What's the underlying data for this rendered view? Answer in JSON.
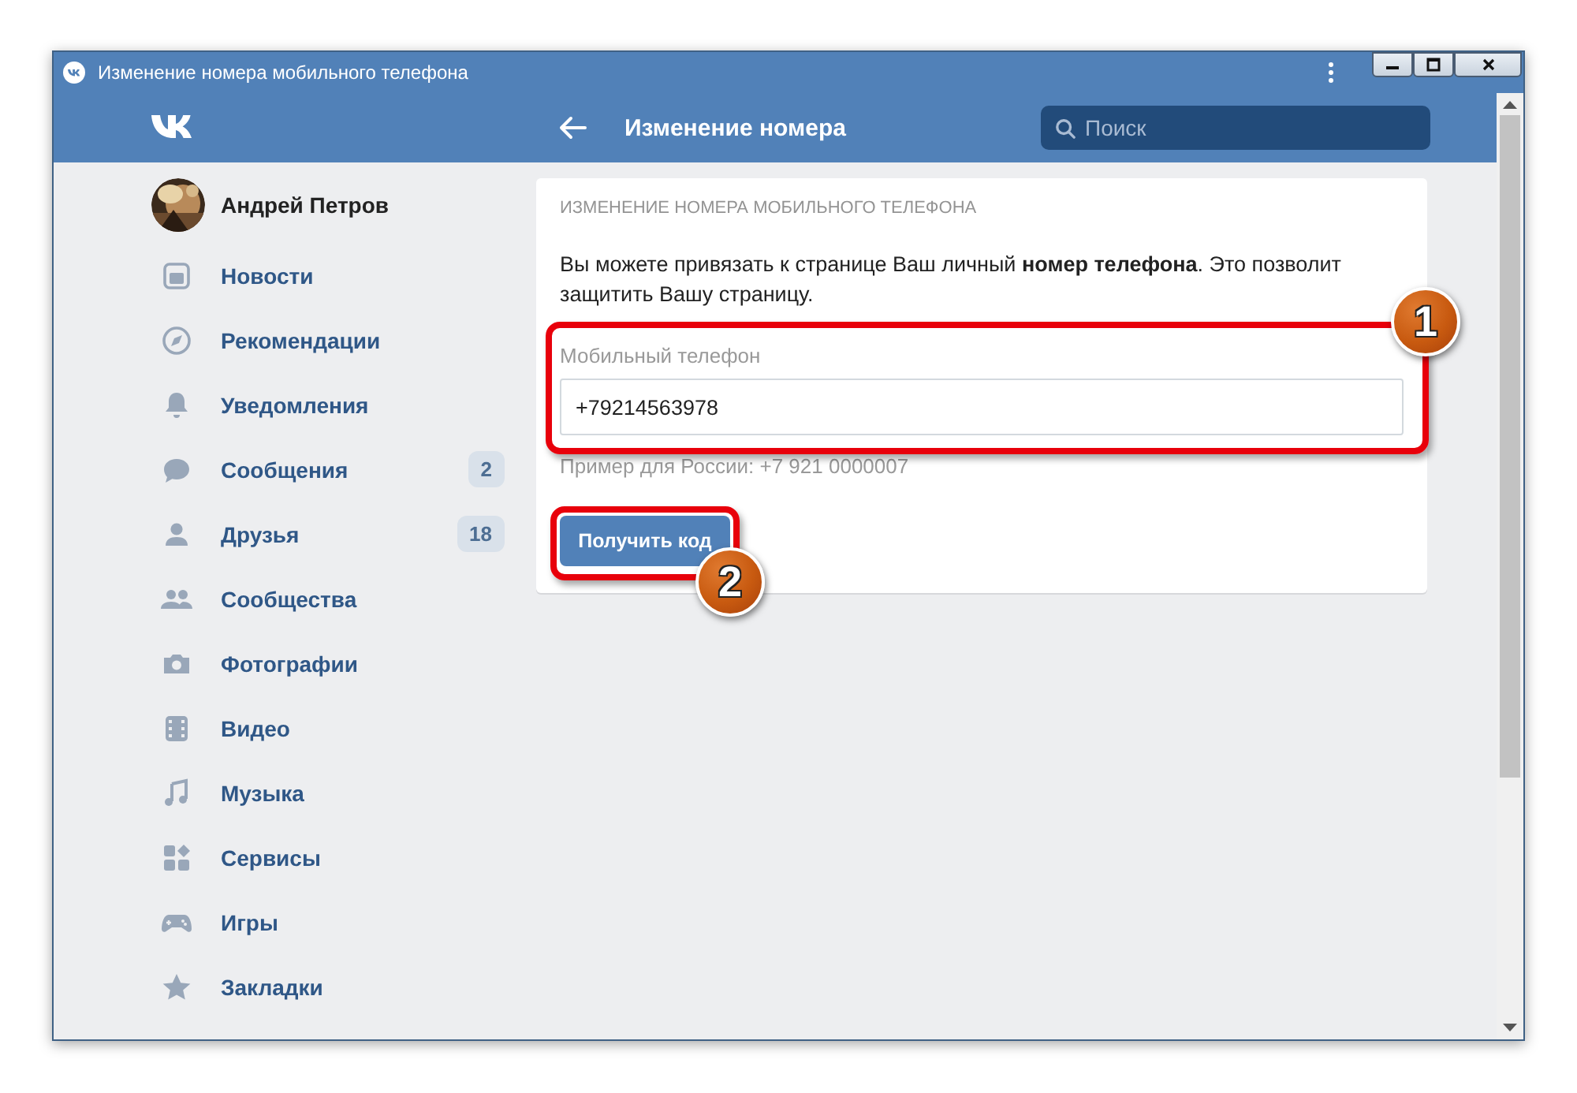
{
  "window": {
    "title": "Изменение номера мобильного телефона"
  },
  "header": {
    "title": "Изменение номера",
    "search": {
      "placeholder": "Поиск"
    }
  },
  "sidebar": {
    "user": {
      "name": "Андрей Петров"
    },
    "items": [
      {
        "label": "Новости"
      },
      {
        "label": "Рекомендации"
      },
      {
        "label": "Уведомления"
      },
      {
        "label": "Сообщения",
        "badge": "2"
      },
      {
        "label": "Друзья",
        "badge": "18"
      },
      {
        "label": "Сообщества"
      },
      {
        "label": "Фотографии"
      },
      {
        "label": "Видео"
      },
      {
        "label": "Музыка"
      },
      {
        "label": "Сервисы"
      },
      {
        "label": "Игры"
      },
      {
        "label": "Закладки"
      }
    ]
  },
  "card": {
    "heading": "ИЗМЕНЕНИЕ НОМЕРА МОБИЛЬНОГО ТЕЛЕФОНА",
    "text": "Вы можете привязать к странице Ваш личный **номер телефона**. Это позволит защитить Вашу страницу.",
    "field": {
      "label": "Мобильный телефон",
      "value": "+79214563978"
    },
    "hint": "Пример для России: +7 921 0000007",
    "button": "Получить код"
  },
  "callouts": [
    {
      "number": "1"
    },
    {
      "number": "2"
    }
  ]
}
